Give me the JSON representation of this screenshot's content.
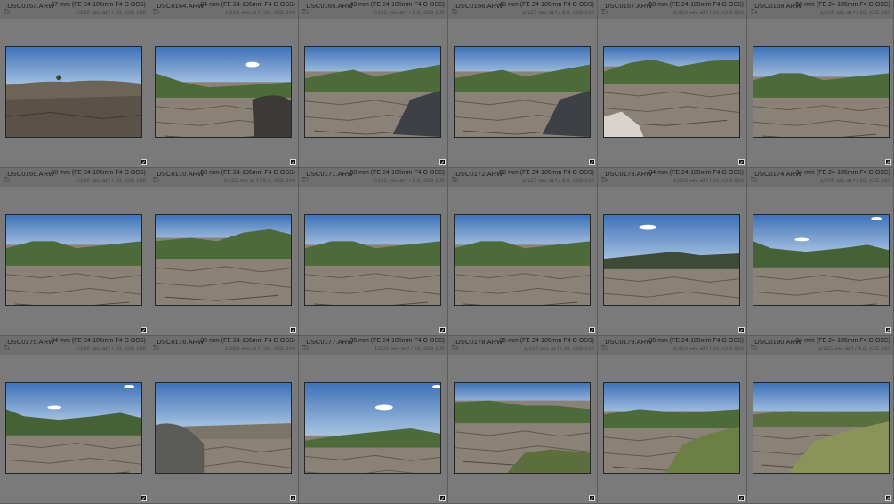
{
  "photos": [
    {
      "file": "_DSC0163.ARW",
      "index": "19",
      "lens": "27 mm (FE 24-105mm F4 G OSS)",
      "exposure": "1/250 sec at f / 10, ISO 100",
      "scene": "rock-close"
    },
    {
      "file": "_DSC0164.ARW",
      "index": "20",
      "lens": "24 mm (FE 24-105mm F4 G OSS)",
      "exposure": "1/160 sec at f / 10, ISO 100",
      "scene": "valley-boulder"
    },
    {
      "file": "_DSC0165.ARW",
      "index": "21",
      "lens": "49 mm (FE 24-105mm F4 G OSS)",
      "exposure": "1/125 sec at f / 9.0, ISO 100",
      "scene": "mountain-boulder"
    },
    {
      "file": "_DSC0166.ARW",
      "index": "22",
      "lens": "49 mm (FE 24-105mm F4 G OSS)",
      "exposure": "1/125 sec at f / 9.0, ISO 100",
      "scene": "mountain-boulder"
    },
    {
      "file": "_DSC0167.ARW",
      "index": "23",
      "lens": "50 mm (FE 24-105mm F4 G OSS)",
      "exposure": "1/160 sec at f / 10, ISO 100",
      "scene": "mountain-white-rock"
    },
    {
      "file": "_DSC0168.ARW",
      "index": "24",
      "lens": "50 mm (FE 24-105mm F4 G OSS)",
      "exposure": "1/160 sec at f / 10, ISO 100",
      "scene": "mountain-rocky"
    },
    {
      "file": "_DSC0169.ARW",
      "index": "25",
      "lens": "50 mm (FE 24-105mm F4 G OSS)",
      "exposure": "1/160 sec at f / 10, ISO 100",
      "scene": "mountain-rocky"
    },
    {
      "file": "_DSC0170.ARW",
      "index": "26",
      "lens": "50 mm (FE 24-105mm F4 G OSS)",
      "exposure": "1/125 sec at f / 9.0, ISO 100",
      "scene": "ridge-rocky"
    },
    {
      "file": "_DSC0171.ARW",
      "index": "27",
      "lens": "50 mm (FE 24-105mm F4 G OSS)",
      "exposure": "1/125 sec at f / 9.0, ISO 100",
      "scene": "mountain-rocky"
    },
    {
      "file": "_DSC0172.ARW",
      "index": "28",
      "lens": "50 mm (FE 24-105mm F4 G OSS)",
      "exposure": "1/125 sec at f / 9.0, ISO 100",
      "scene": "mountain-rocky"
    },
    {
      "file": "_DSC0173.ARW",
      "index": "29",
      "lens": "34 mm (FE 24-105mm F4 G OSS)",
      "exposure": "1/320 sec at f / 10, ISO 100",
      "scene": "big-sky-valley"
    },
    {
      "file": "_DSC0174.ARW",
      "index": "30",
      "lens": "34 mm (FE 24-105mm F4 G OSS)",
      "exposure": "1/200 sec at f / 10, ISO 100",
      "scene": "big-sky-hills"
    },
    {
      "file": "_DSC0175.ARW",
      "index": "31",
      "lens": "34 mm (FE 24-105mm F4 G OSS)",
      "exposure": "1/160 sec at f / 10, ISO 100",
      "scene": "big-sky-hills"
    },
    {
      "file": "_DSC0176.ARW",
      "index": "32",
      "lens": "35 mm (FE 24-105mm F4 G OSS)",
      "exposure": "1/320 sec at f / 10, ISO 100",
      "scene": "rock-foreground"
    },
    {
      "file": "_DSC0177.ARW",
      "index": "33",
      "lens": "35 mm (FE 24-105mm F4 G OSS)",
      "exposure": "1/250 sec at f / 10, ISO 100",
      "scene": "big-sky-low-ridge"
    },
    {
      "file": "_DSC0178.ARW",
      "index": "34",
      "lens": "35 mm (FE 24-105mm F4 G OSS)",
      "exposure": "1/160 sec at f / 10, ISO 100",
      "scene": "ridge-grass"
    },
    {
      "file": "_DSC0179.ARW",
      "index": "35",
      "lens": "35 mm (FE 24-105mm F4 G OSS)",
      "exposure": "1/160 sec at f / 10, ISO 100",
      "scene": "grass-foreground"
    },
    {
      "file": "_DSC0180.ARW",
      "index": "36",
      "lens": "24 mm (FE 24-105mm F4 G OSS)",
      "exposure": "1/125 sec at f / 9.0, ISO 100",
      "scene": "grass-foreground-bright"
    }
  ],
  "colors": {
    "cell_bg": "#7a7a7a",
    "header_bg": "#6e6e6e",
    "sky_top": "#3f72b8",
    "sky_bottom": "#b9d0e8",
    "mountain": "#4d6a3a",
    "rock": "#8a8276"
  },
  "icons": {
    "badge": "edit-badge-icon"
  }
}
